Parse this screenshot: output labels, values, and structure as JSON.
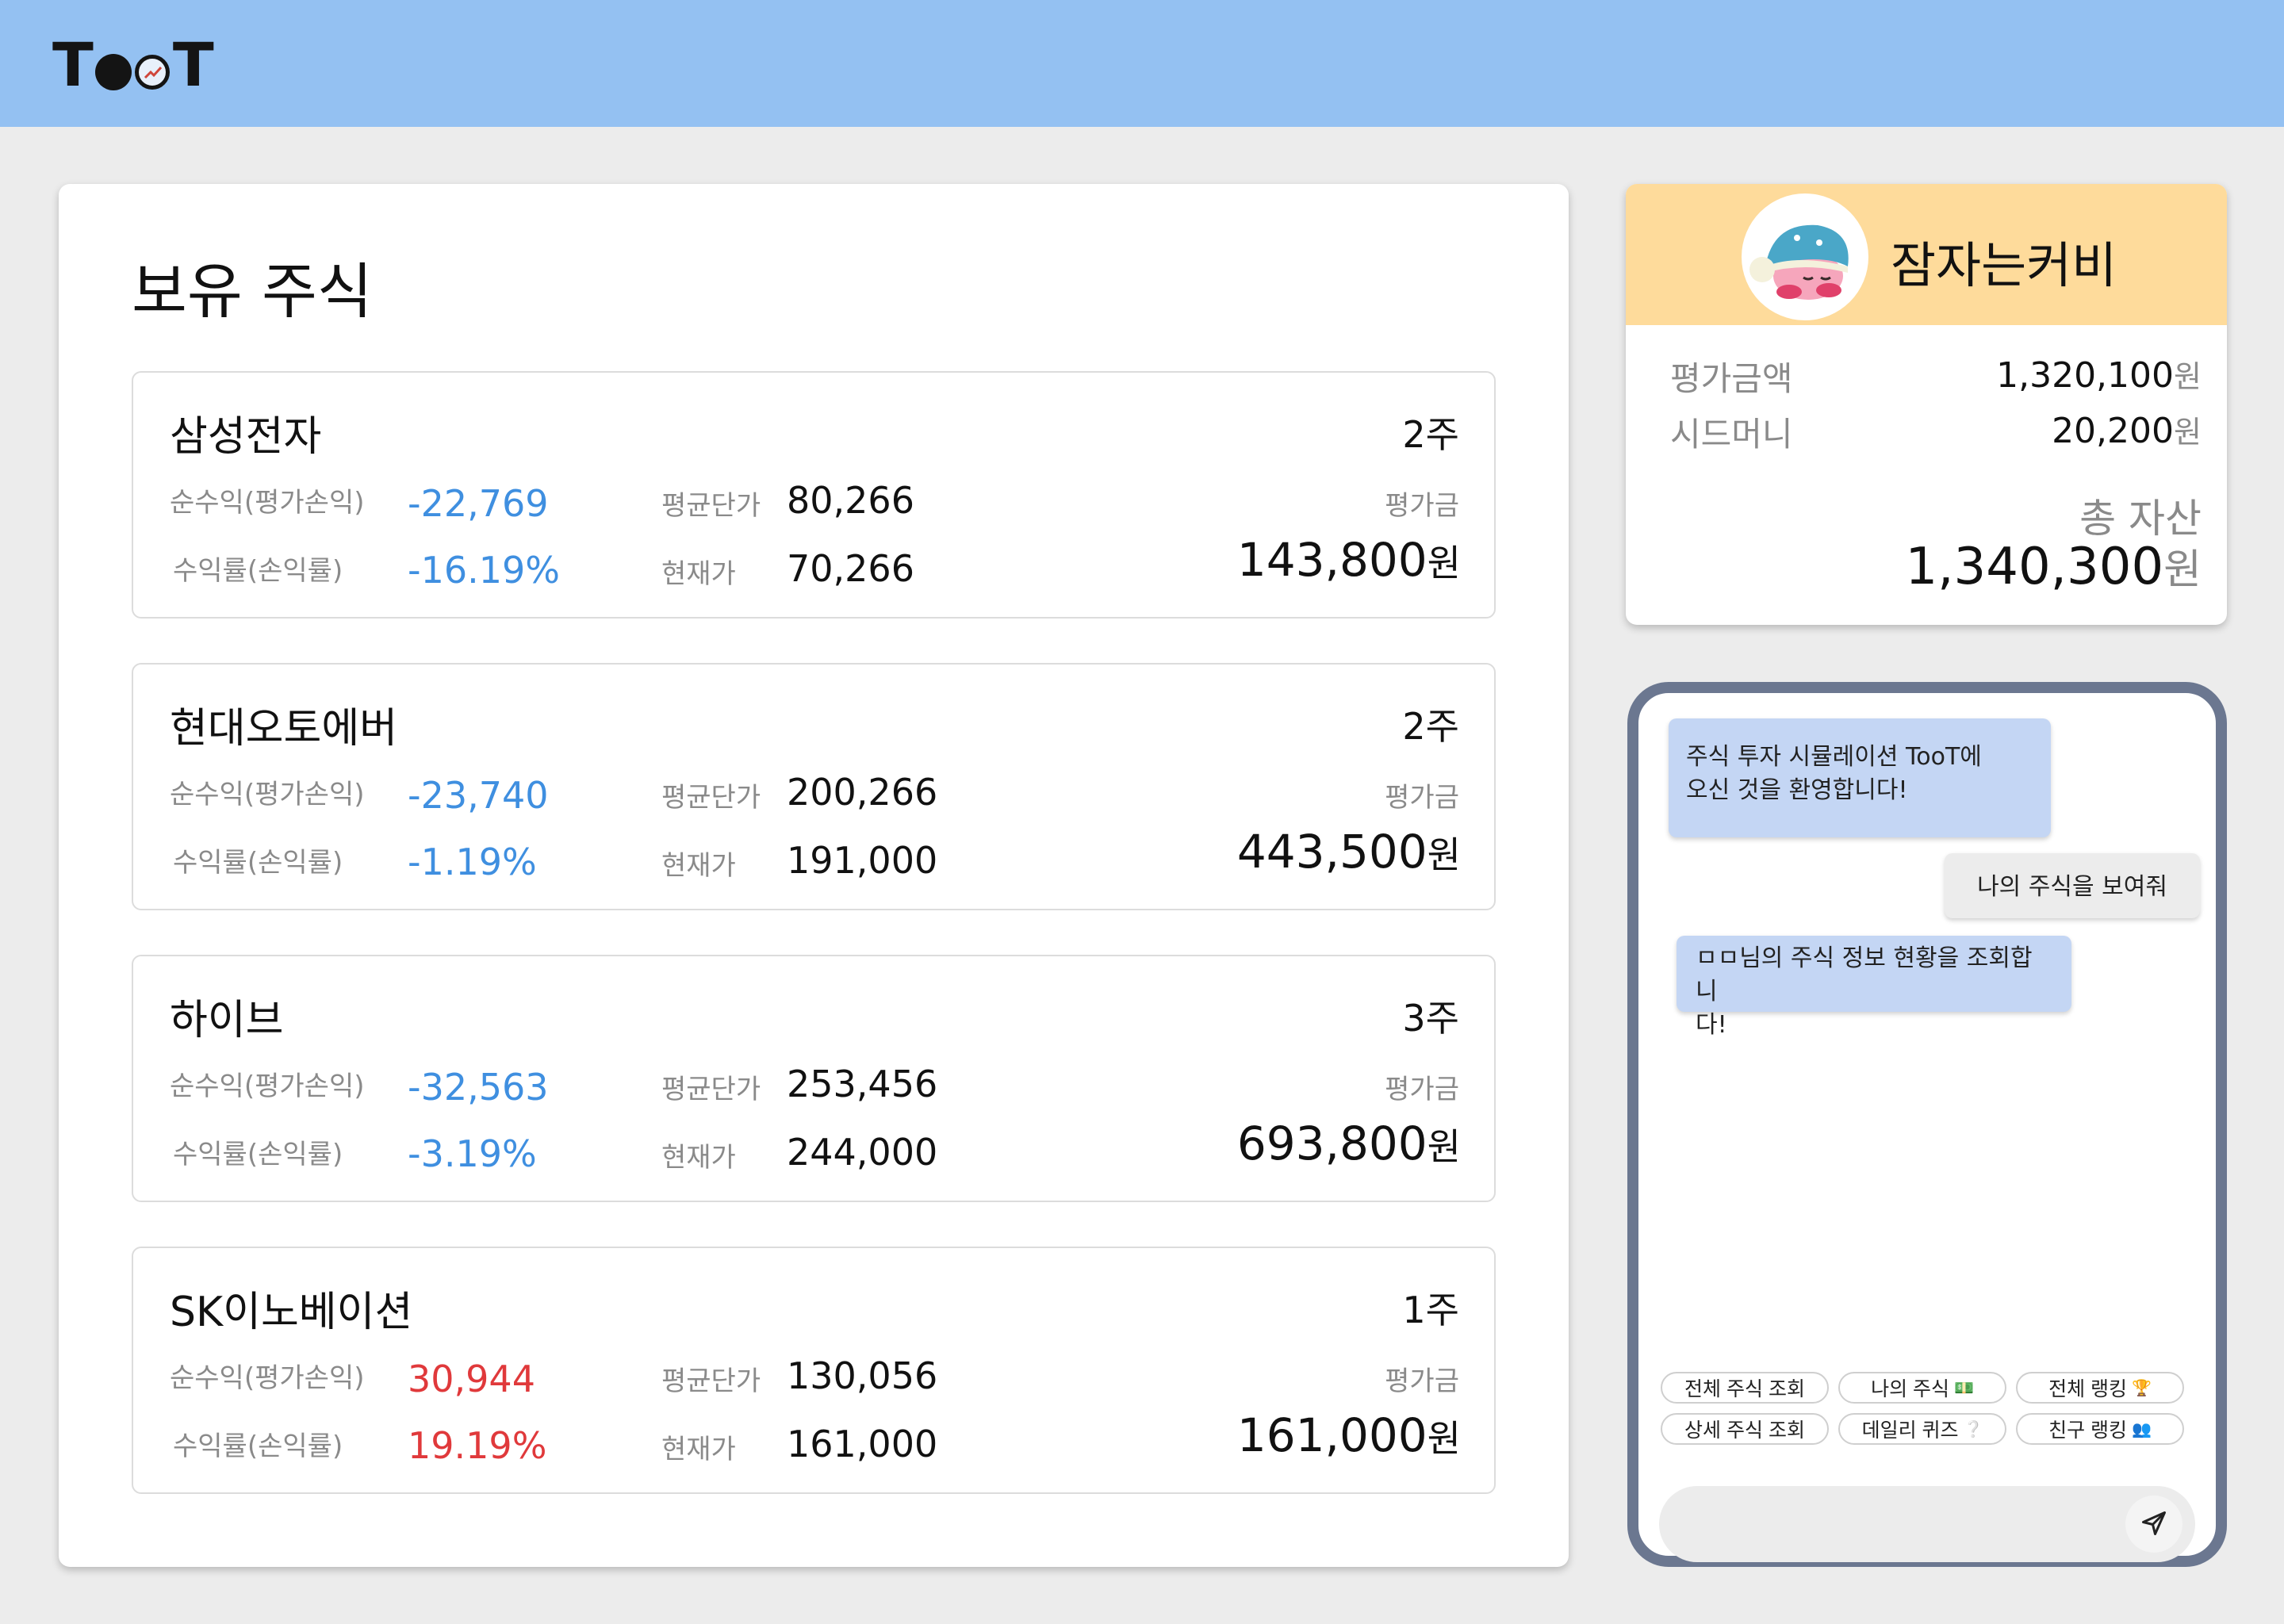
{
  "header": {
    "logo_text": "TooT",
    "logo_icon": "chart-icon"
  },
  "holdings": {
    "title": "보유 주식",
    "labels": {
      "net_profit": "순수익(평가손익)",
      "return_rate": "수익률(손익률)",
      "avg_price": "평균단가",
      "current_price": "현재가",
      "eval_amount": "평가금"
    },
    "stocks": [
      {
        "name": "삼성전자",
        "qty": "2주",
        "net_profit": "-22,769",
        "return_rate": "-16.19%",
        "avg_price": "80,266",
        "current_price": "70,266",
        "eval_amount": "143,800",
        "unit": "원",
        "sign": "neg"
      },
      {
        "name": "현대오토에버",
        "qty": "2주",
        "net_profit": "-23,740",
        "return_rate": "-1.19%",
        "avg_price": "200,266",
        "current_price": "191,000",
        "eval_amount": "443,500",
        "unit": "원",
        "sign": "neg"
      },
      {
        "name": "하이브",
        "qty": "3주",
        "net_profit": "-32,563",
        "return_rate": "-3.19%",
        "avg_price": "253,456",
        "current_price": "244,000",
        "eval_amount": "693,800",
        "unit": "원",
        "sign": "neg"
      },
      {
        "name": "SK이노베이션",
        "qty": "1주",
        "net_profit": "30,944",
        "return_rate": "19.19%",
        "avg_price": "130,056",
        "current_price": "161,000",
        "eval_amount": "161,000",
        "unit": "원",
        "sign": "pos"
      }
    ]
  },
  "profile": {
    "username": "잠자는커비",
    "avatar_icon": "sleeping-kirby-avatar",
    "eval_label": "평가금액",
    "eval_value": "1,320,100",
    "seed_label": "시드머니",
    "seed_value": "20,200",
    "unit": "원",
    "total_label": "총 자산",
    "total_value": "1,340,300"
  },
  "chat": {
    "messages": [
      {
        "from": "bot",
        "text": "주식 투자 시뮬레이션 TooT에\n오신 것을 환영합니다!"
      },
      {
        "from": "user",
        "text": "나의 주식을 보여줘"
      },
      {
        "from": "bot",
        "text": "ㅁㅁ님의 주식 정보 현황을 조회합니\n다!"
      }
    ],
    "quick_actions": [
      {
        "label": "전체 주식 조회",
        "icon": ""
      },
      {
        "label": "나의 주식",
        "icon": "money-icon"
      },
      {
        "label": "전체 랭킹",
        "icon": "trophy-icon"
      },
      {
        "label": "상세 주식 조회",
        "icon": ""
      },
      {
        "label": "데일리 퀴즈",
        "icon": "question-icon"
      },
      {
        "label": "친구 랭킹",
        "icon": "people-icon"
      }
    ],
    "input_placeholder": "",
    "send_icon": "send-icon"
  },
  "colors": {
    "header_bg": "#94c1f2",
    "profile_head_bg": "#fedb9b",
    "negative": "#3f8fe0",
    "positive": "#e0393b",
    "chat_border": "#6b7790",
    "bot_bubble": "#c4d6f4"
  }
}
